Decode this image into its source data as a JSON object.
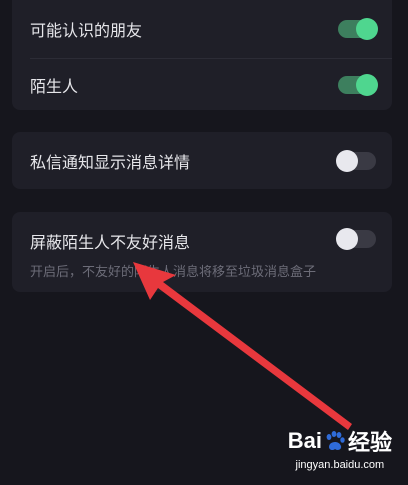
{
  "privacy": {
    "card1": {
      "items": [
        {
          "label": "可能认识的朋友",
          "enabled": true
        },
        {
          "label": "陌生人",
          "enabled": true
        }
      ]
    },
    "card2": {
      "label": "私信通知显示消息详情",
      "enabled": false
    },
    "card3": {
      "label": "屏蔽陌生人不友好消息",
      "description": "开启后，不友好的陌生人消息将移至垃圾消息盒子",
      "enabled": false
    }
  },
  "colors": {
    "background": "#16161d",
    "card": "#1f1f28",
    "toggle_on": "#4fd68f",
    "toggle_off_knob": "#e8e8ee",
    "annotation_arrow": "#e8383d"
  },
  "watermark": {
    "logo_text_1": "Bai",
    "logo_text_2": "经验",
    "url": "jingyan.baidu.com"
  }
}
